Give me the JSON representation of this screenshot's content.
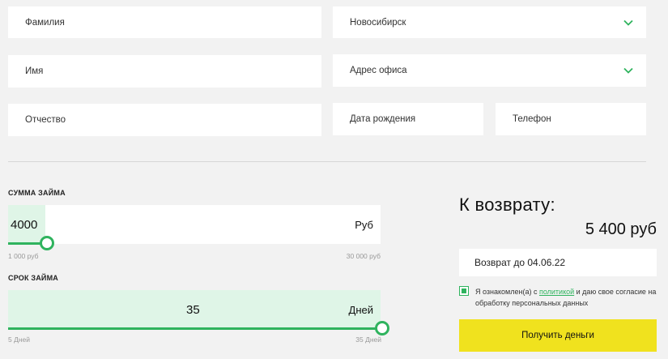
{
  "form": {
    "last_name_placeholder": "Фамилия",
    "first_name_placeholder": "Имя",
    "middle_name_placeholder": "Отчество",
    "city_value": "Новосибирск",
    "office_address_placeholder": "Адрес офиса",
    "birth_date_placeholder": "Дата рождения",
    "phone_placeholder": "Телефон"
  },
  "loan_amount": {
    "label": "СУММА ЗАЙМА",
    "value": "4000",
    "unit": "Руб",
    "min_label": "1 000 руб",
    "max_label": "30 000 руб"
  },
  "loan_term": {
    "label": "СРОК ЗАЙМА",
    "value": "35",
    "unit": "Дней",
    "min_label": "5 Дней",
    "max_label": "35 Дней"
  },
  "summary": {
    "title": "К возврату:",
    "amount": "5 400 руб",
    "return_date": "Возврат до 04.06.22"
  },
  "consent": {
    "text_before": "Я ознакомлен(а) с ",
    "link_text": "политикой",
    "text_after": " и даю свое согласие на обработку персональных данных",
    "checked": true
  },
  "submit_label": "Получить деньги",
  "colors": {
    "accent_green": "#2fb35e",
    "light_green": "#dff5e7",
    "button_yellow": "#f0e21e"
  }
}
